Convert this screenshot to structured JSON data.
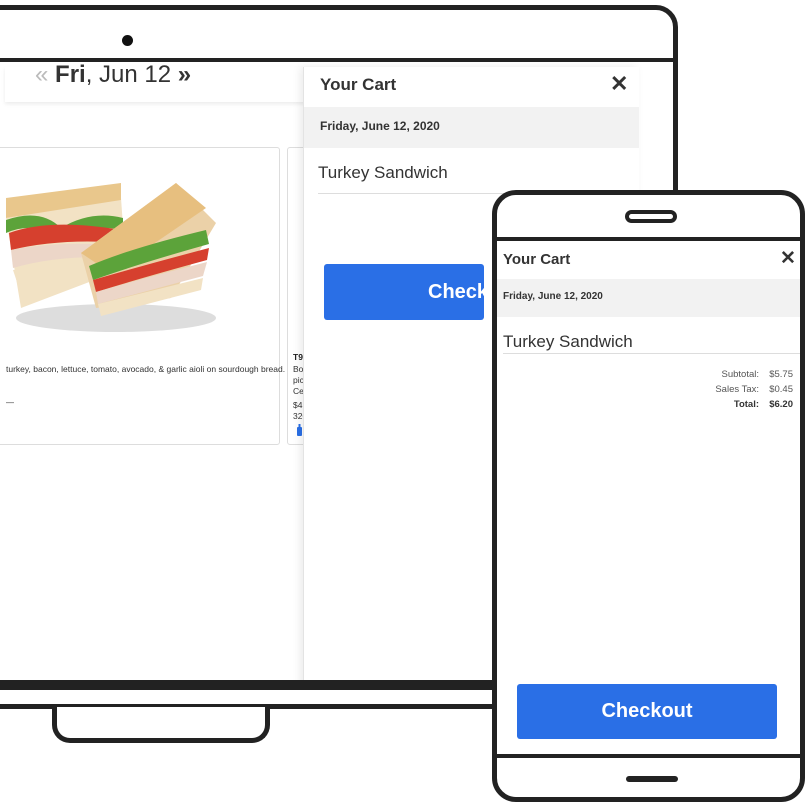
{
  "laptop": {
    "date_nav": {
      "prev": "«",
      "day": "Fri",
      "rest": ", Jun 12",
      "next": "»"
    },
    "menu_cards": [
      {
        "description": "turkey, bacon, lettuce, tomato, avocado, & garlic aioli on sourdough bread."
      },
      {
        "title": "T90 Stack",
        "lines": [
          "Boar's Head G",
          "pickled red on",
          "Central hoagie",
          "$4.99 / $7.00",
          "320 / 640 Cal"
        ],
        "diet_icons": [
          "bottle-icon",
          "egg-icon",
          "wheat-icon"
        ]
      }
    ],
    "cart": {
      "title": "Your Cart",
      "close": "✕",
      "date": "Friday, June 12, 2020",
      "item": "Turkey Sandwich",
      "checkout": "Checkout"
    }
  },
  "phone": {
    "cart": {
      "title": "Your Cart",
      "close": "✕",
      "date": "Friday, June 12, 2020",
      "item": "Turkey Sandwich",
      "summary": {
        "subtotal_label": "Subtotal:",
        "subtotal": "$5.75",
        "tax_label": "Sales Tax:",
        "tax": "$0.45",
        "total_label": "Total:",
        "total": "$6.20"
      },
      "checkout": "Checkout"
    }
  },
  "colors": {
    "accent": "#2a6fe6",
    "frame": "#222222",
    "date_bar": "#f2f2f2"
  }
}
